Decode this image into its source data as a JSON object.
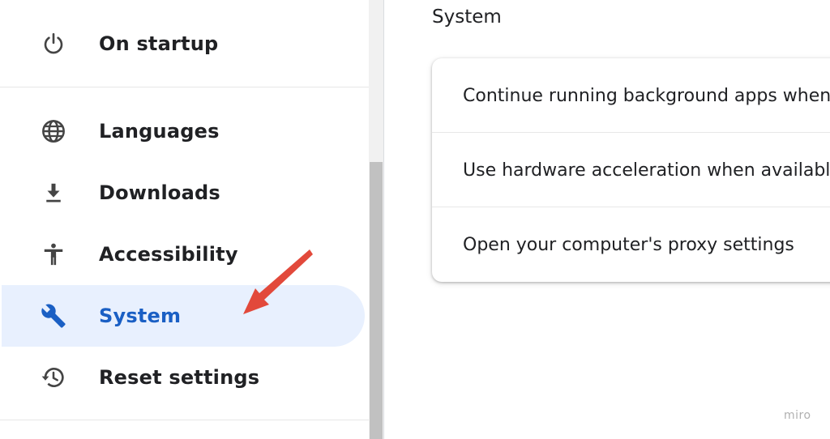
{
  "sidebar": {
    "items": [
      {
        "label": "On startup",
        "icon": "power-icon"
      },
      {
        "label": "Languages",
        "icon": "globe-icon"
      },
      {
        "label": "Downloads",
        "icon": "download-icon"
      },
      {
        "label": "Accessibility",
        "icon": "accessibility-icon"
      },
      {
        "label": "System",
        "icon": "wrench-icon",
        "active": true
      },
      {
        "label": "Reset settings",
        "icon": "history-icon"
      }
    ]
  },
  "main": {
    "section_title": "System",
    "rows": [
      {
        "label": "Continue running background apps when"
      },
      {
        "label": "Use hardware acceleration when available"
      },
      {
        "label": "Open your computer's proxy settings"
      }
    ]
  },
  "watermark": "miro",
  "colors": {
    "active_bg": "#e8f0fe",
    "active_text": "#1a5fc4",
    "arrow": "#e2493b"
  }
}
